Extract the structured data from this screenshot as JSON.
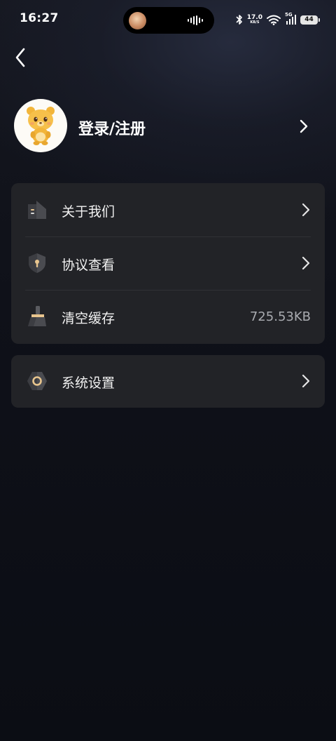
{
  "status_bar": {
    "time": "16:27",
    "net_speed_value": "17.0",
    "net_speed_unit": "KB/S",
    "signal_label": "5G",
    "battery": "44"
  },
  "profile": {
    "label": "登录/注册"
  },
  "menu_group_1": {
    "items": [
      {
        "label": "关于我们",
        "icon": "building-icon"
      },
      {
        "label": "协议查看",
        "icon": "shield-keyhole-icon"
      },
      {
        "label": "清空缓存",
        "icon": "broom-icon",
        "value": "725.53KB"
      }
    ]
  },
  "menu_group_2": {
    "items": [
      {
        "label": "系统设置",
        "icon": "hex-gear-icon"
      }
    ]
  },
  "colors": {
    "background": "#0f1119",
    "card": "#222327",
    "text": "#ffffff",
    "secondary_text": "#a9abb0",
    "icon_accent": "#e8c58e"
  }
}
